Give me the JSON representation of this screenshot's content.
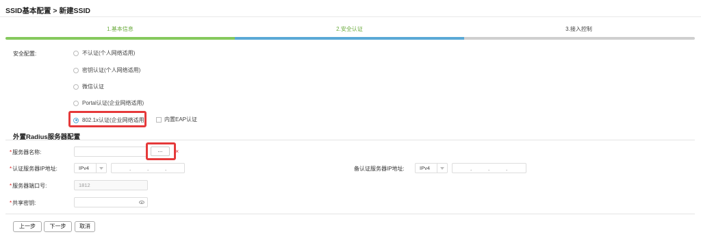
{
  "header": {
    "breadcrumb": "SSID基本配置 > 新建SSID"
  },
  "steps": [
    {
      "label": "1.基本信息"
    },
    {
      "label": "2.安全认证"
    },
    {
      "label": "3.接入控制"
    }
  ],
  "security": {
    "label": "安全配置:",
    "options": [
      {
        "label": "不认证(个人网络适用)",
        "selected": false
      },
      {
        "label": "密钥认证(个人网络适用)",
        "selected": false
      },
      {
        "label": "微信认证",
        "selected": false
      },
      {
        "label": "Portal认证(企业网络适用)",
        "selected": false
      },
      {
        "label": "802.1x认证(企业网络适用)",
        "selected": true
      }
    ],
    "builtin_eap": {
      "label": "内置EAP认证",
      "checked": false
    }
  },
  "radius": {
    "section_title": "外置Radius服务器配置",
    "server_name": {
      "label": "服务器名称:",
      "required_mark": "*",
      "value": "",
      "browse_label": "...",
      "error_mark": "×"
    },
    "auth_ip": {
      "label": "认证服务器IP地址:",
      "required_mark": "*",
      "ip_version": "IPv4",
      "dots": ".      .      ."
    },
    "backup_ip": {
      "label": "备认证服务器IP地址:",
      "ip_version": "IPv4",
      "dots": ".      .      ."
    },
    "port": {
      "label": "服务器端口号:",
      "required_mark": "*",
      "placeholder": "1812"
    },
    "secret": {
      "label": "共享密钥:",
      "required_mark": "*",
      "value": ""
    }
  },
  "footer": {
    "prev_label": "上一步",
    "next_label": "下一步",
    "cancel_label": "取消"
  },
  "colors": {
    "step_done": "#85c95d",
    "step_active": "#5aa9d6",
    "step_pending": "#cfcfcf",
    "highlight": "#e5393a"
  }
}
